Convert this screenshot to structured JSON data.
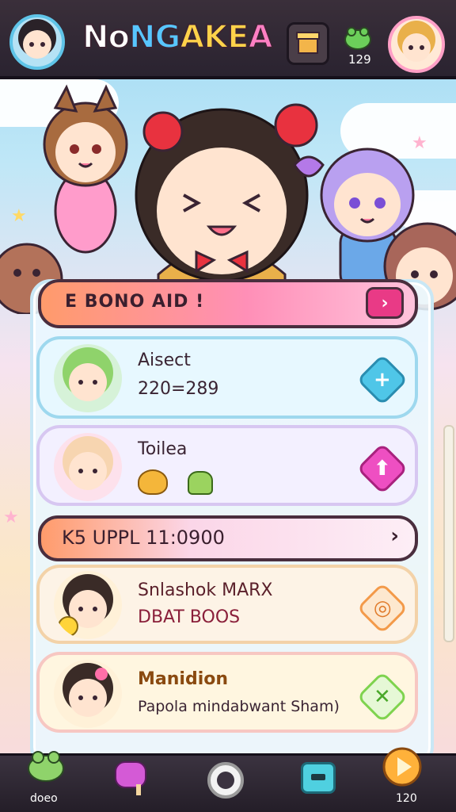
{
  "header": {
    "logo": [
      "No",
      "NG",
      "AKE",
      "A"
    ],
    "counter": "129"
  },
  "banner": {
    "title": "E BONO AID !",
    "arrow": "›"
  },
  "cards": [
    {
      "title": "Aisect",
      "subtitle": "220=289",
      "action": "+",
      "color": "#4fc6e8",
      "icon": "plus-icon"
    },
    {
      "title": "Toilea",
      "subtitle": "",
      "action": "⬆",
      "color": "#ee4fc2",
      "icon": "up-arrow-icon"
    },
    {
      "title": "Snlashok MARX",
      "subtitle": "DBAT BOOS",
      "action": "◎",
      "color": "#f39a4a",
      "icon": "target-icon"
    },
    {
      "title": "Manidion",
      "subtitle": "Papola mindabwant Sham)",
      "action": "✕",
      "color": "#7fd34f",
      "icon": "cross-icon"
    }
  ],
  "event_bar": {
    "text": "K5 UPPL 11:0900",
    "arrow": "›"
  },
  "bottom_nav": {
    "left_label": "doeo",
    "right_label": "120"
  }
}
